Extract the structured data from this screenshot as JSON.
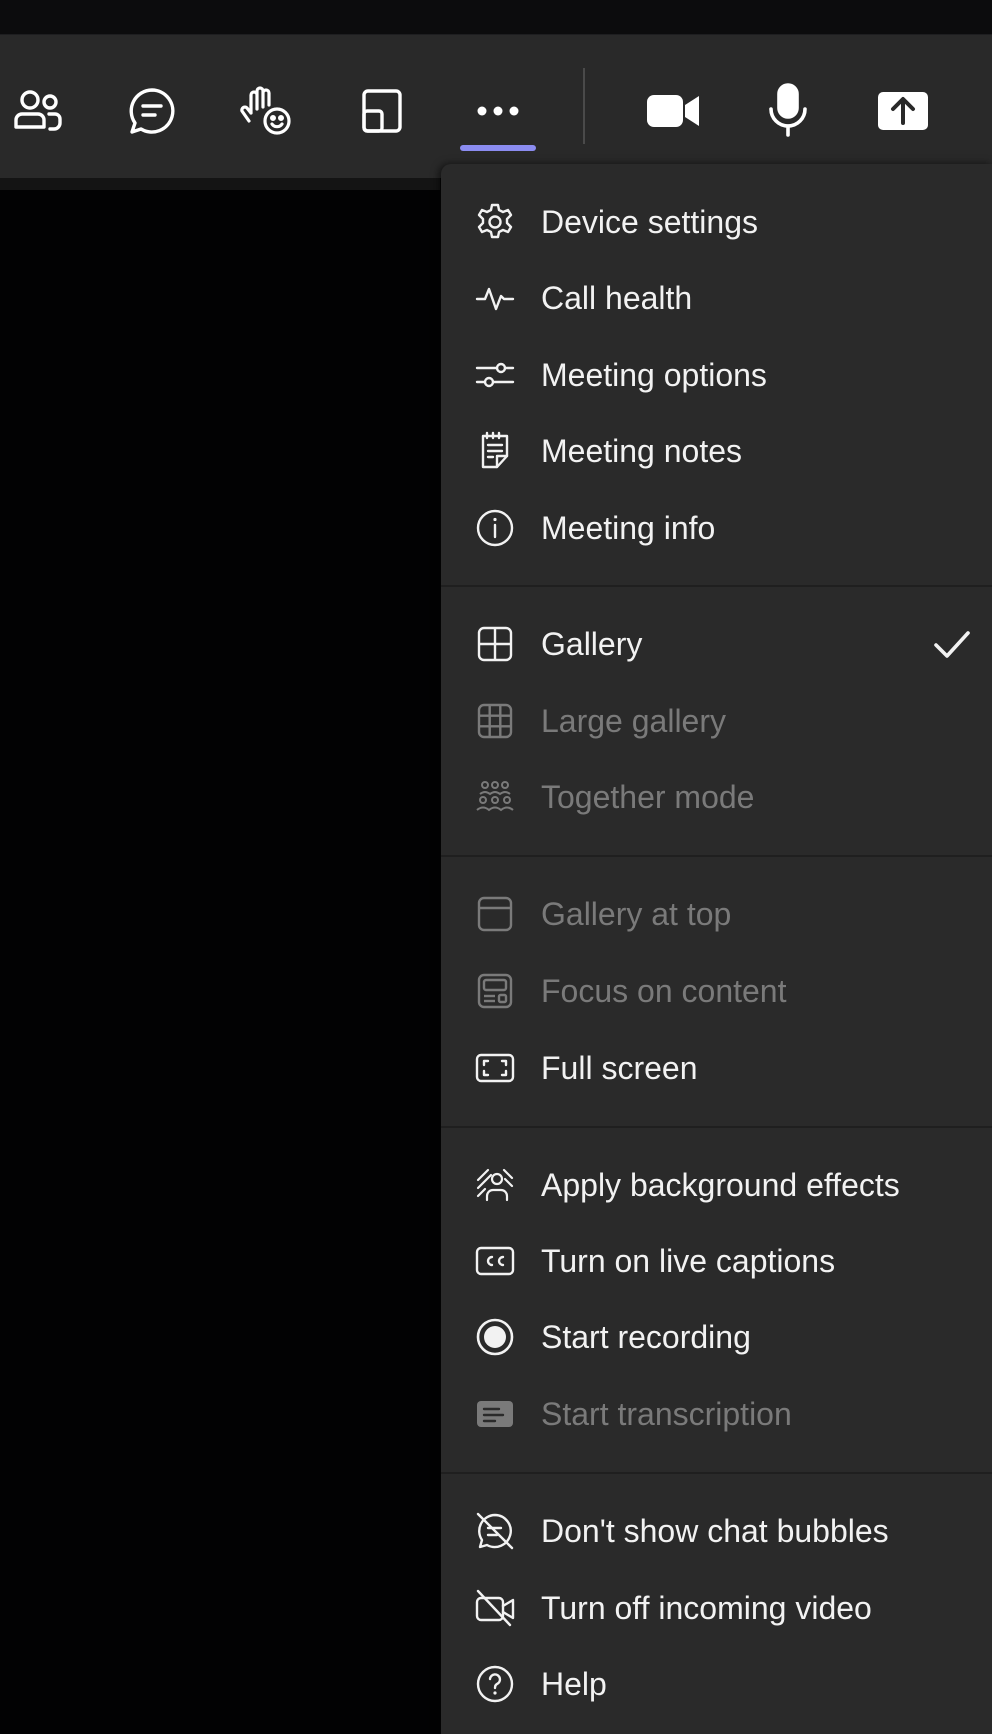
{
  "colors": {
    "toolbar_bg": "#292929",
    "menu_bg": "#2a2a2a",
    "accent": "#8b8cf0",
    "text": "#f2f2f2",
    "text_disabled": "#7a7a7a"
  },
  "toolbar": {
    "buttons": [
      {
        "name": "people-button",
        "icon": "people-icon"
      },
      {
        "name": "chat-button",
        "icon": "chat-icon"
      },
      {
        "name": "react-button",
        "icon": "raise-hand-emoji-icon"
      },
      {
        "name": "rooms-button",
        "icon": "view-icon"
      },
      {
        "name": "more-actions-button",
        "icon": "more-horizontal-icon",
        "active": true
      },
      {
        "name": "camera-button",
        "icon": "video-camera-icon"
      },
      {
        "name": "mic-button",
        "icon": "microphone-icon"
      },
      {
        "name": "share-button",
        "icon": "share-upload-icon"
      }
    ]
  },
  "menu": {
    "groups": [
      {
        "items": [
          {
            "label": "Device settings",
            "icon": "gear-icon",
            "disabled": false
          },
          {
            "label": "Call health",
            "icon": "pulse-icon",
            "disabled": false
          },
          {
            "label": "Meeting options",
            "icon": "sliders-icon",
            "disabled": false
          },
          {
            "label": "Meeting notes",
            "icon": "notes-icon",
            "disabled": false
          },
          {
            "label": "Meeting info",
            "icon": "info-icon",
            "disabled": false
          }
        ]
      },
      {
        "items": [
          {
            "label": "Gallery",
            "icon": "grid-icon",
            "disabled": false,
            "checked": true
          },
          {
            "label": "Large gallery",
            "icon": "large-grid-icon",
            "disabled": true
          },
          {
            "label": "Together mode",
            "icon": "together-mode-icon",
            "disabled": true
          }
        ]
      },
      {
        "items": [
          {
            "label": "Gallery at top",
            "icon": "gallery-top-icon",
            "disabled": true
          },
          {
            "label": "Focus on content",
            "icon": "focus-content-icon",
            "disabled": true
          },
          {
            "label": "Full screen",
            "icon": "full-screen-icon",
            "disabled": false
          }
        ]
      },
      {
        "items": [
          {
            "label": "Apply background effects",
            "icon": "background-effects-icon",
            "disabled": false
          },
          {
            "label": "Turn on live captions",
            "icon": "closed-captions-icon",
            "disabled": false
          },
          {
            "label": "Start recording",
            "icon": "record-icon",
            "disabled": false
          },
          {
            "label": "Start transcription",
            "icon": "transcription-icon",
            "disabled": true
          }
        ]
      },
      {
        "items": [
          {
            "label": "Don't show chat bubbles",
            "icon": "chat-bubbles-off-icon",
            "disabled": false
          },
          {
            "label": "Turn off incoming video",
            "icon": "video-off-icon",
            "disabled": false
          },
          {
            "label": "Help",
            "icon": "help-icon",
            "disabled": false
          }
        ]
      }
    ]
  }
}
